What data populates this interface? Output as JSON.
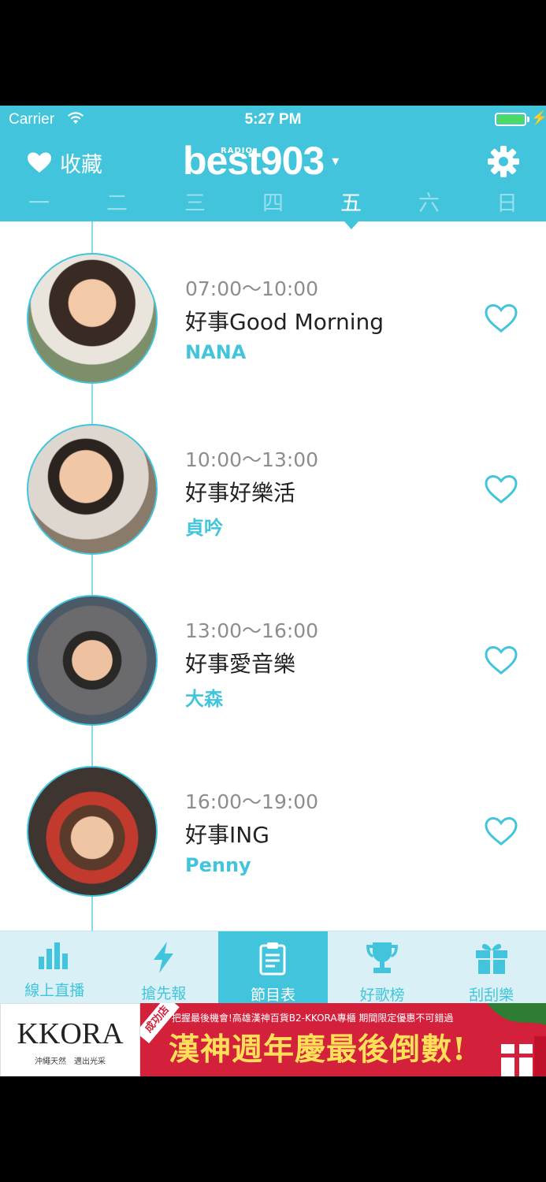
{
  "status": {
    "carrier": "Carrier",
    "time": "5:27 PM"
  },
  "header": {
    "favorites_label": "收藏",
    "logo_small": "RADIO",
    "logo_text": "best903",
    "logo_caret": "▾"
  },
  "days": [
    {
      "label": "一",
      "active": false
    },
    {
      "label": "二",
      "active": false
    },
    {
      "label": "三",
      "active": false
    },
    {
      "label": "四",
      "active": false
    },
    {
      "label": "五",
      "active": true
    },
    {
      "label": "六",
      "active": false
    },
    {
      "label": "日",
      "active": false
    }
  ],
  "programs": [
    {
      "time": "07:00～10:00",
      "title": "好事Good Morning",
      "host": "NANA"
    },
    {
      "time": "10:00～13:00",
      "title": "好事好樂活",
      "host": "貞吟"
    },
    {
      "time": "13:00～16:00",
      "title": "好事愛音樂",
      "host": "大森"
    },
    {
      "time": "16:00～19:00",
      "title": "好事ING",
      "host": "Penny"
    }
  ],
  "tabs": [
    {
      "label": "線上直播",
      "icon": "bar-chart-icon",
      "active": false
    },
    {
      "label": "搶先報",
      "icon": "lightning-icon",
      "active": false
    },
    {
      "label": "節目表",
      "icon": "clipboard-icon",
      "active": true
    },
    {
      "label": "好歌榜",
      "icon": "trophy-icon",
      "active": false
    },
    {
      "label": "刮刮樂",
      "icon": "gift-icon",
      "active": false
    }
  ],
  "ad": {
    "brand": "KKORA",
    "brand_sub": "沖繩天然　邁出光采",
    "tag": "成功店",
    "top_line": "把握最後機會!高雄漢神百貨B2-KKORA專櫃 期間限定優惠不可錯過",
    "headline": "漢神週年慶最後倒數!"
  },
  "colors": {
    "accent": "#42c5dc",
    "tabbar_bg": "#d9f0f6",
    "ad_red": "#d3203b",
    "ad_yellow": "#ffde5a"
  }
}
